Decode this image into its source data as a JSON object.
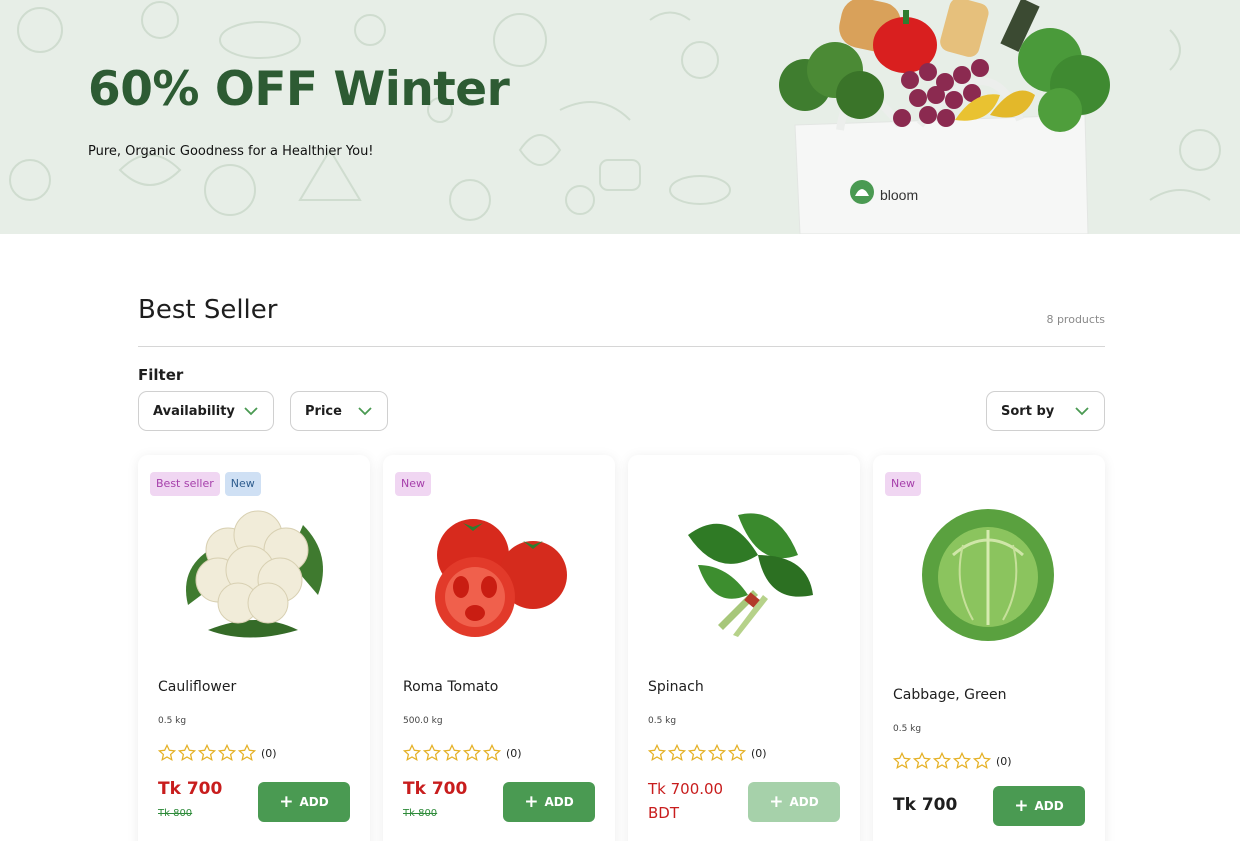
{
  "hero": {
    "title": "60% OFF Winter",
    "subtitle": "Pure, Organic Goodness for a Healthier You!",
    "bag_brand": "bloom"
  },
  "section": {
    "title": "Best Seller",
    "product_count": "8 products",
    "filter_label": "Filter"
  },
  "filters": {
    "availability": "Availability",
    "price": "Price",
    "sort": "Sort by"
  },
  "colors": {
    "brand_green": "#2d5b33",
    "button_green": "#4a9a52",
    "sale_red": "#c81d1d"
  },
  "products": [
    {
      "name": "Cauliflower",
      "weight": "0.5 kg",
      "badges": [
        "Best seller",
        "New"
      ],
      "rating_count": "(0)",
      "price": "Tk 700",
      "old_price": "Tk 800",
      "add_label": "ADD",
      "image_icon": "cauliflower-image"
    },
    {
      "name": "Roma Tomato",
      "weight": "500.0 kg",
      "badges": [
        "New"
      ],
      "rating_count": "(0)",
      "price": "Tk 700",
      "old_price": "Tk 800",
      "add_label": "ADD",
      "image_icon": "tomato-image"
    },
    {
      "name": "Spinach",
      "weight": "0.5 kg",
      "badges": [],
      "rating_count": "(0)",
      "price_line1": "Tk 700.00",
      "price_line2": "BDT",
      "add_label": "ADD",
      "add_disabled": true,
      "image_icon": "spinach-image"
    },
    {
      "name": "Cabbage, Green",
      "weight": "0.5 kg",
      "badges": [
        "New"
      ],
      "rating_count": "(0)",
      "price": "Tk 700",
      "add_label": "ADD",
      "image_icon": "cabbage-image"
    }
  ]
}
